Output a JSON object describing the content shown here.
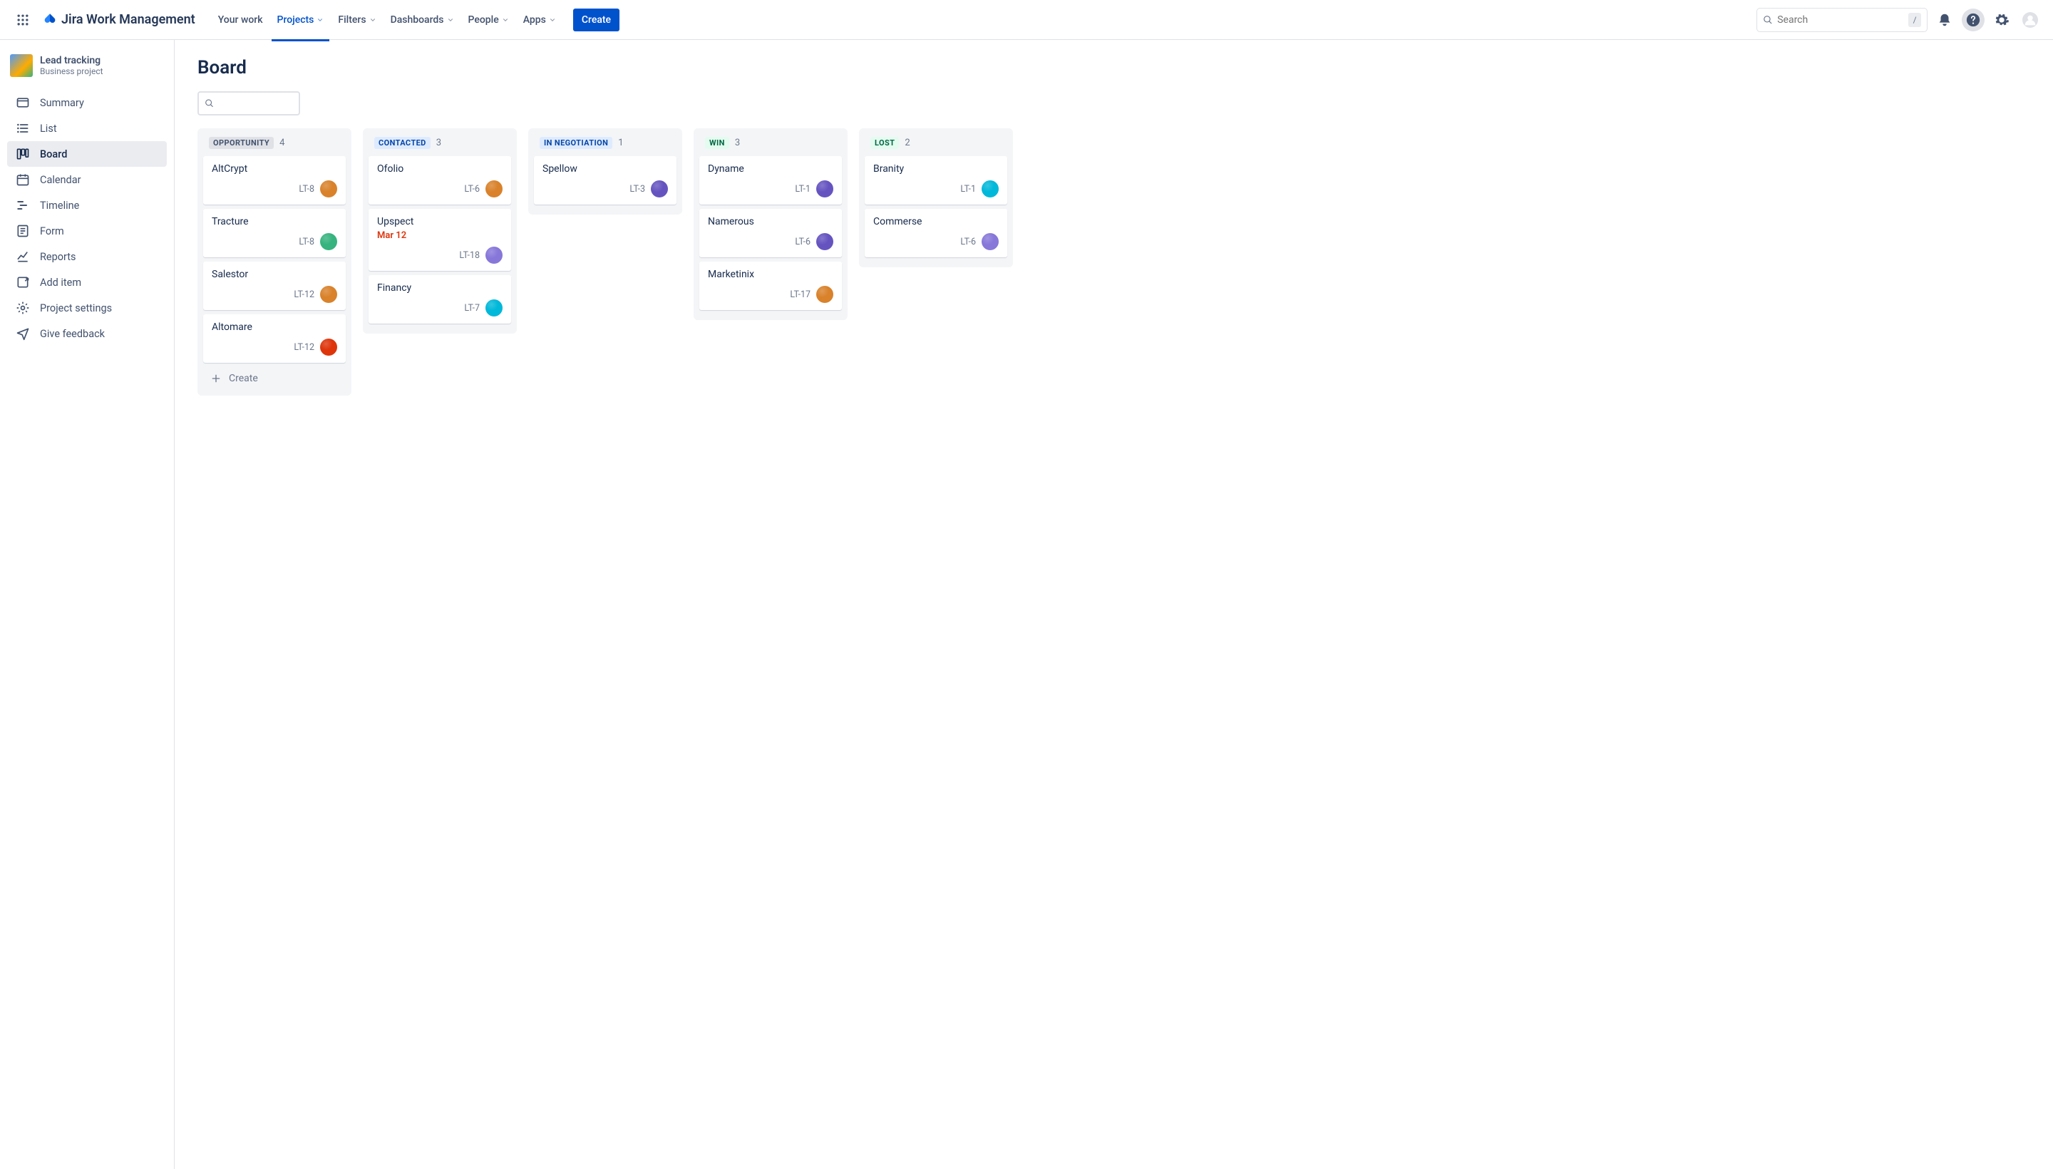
{
  "app": {
    "name": "Jira Work Management"
  },
  "nav": {
    "items": [
      {
        "label": "Your work",
        "dropdown": false,
        "active": false
      },
      {
        "label": "Projects",
        "dropdown": true,
        "active": true
      },
      {
        "label": "Filters",
        "dropdown": true,
        "active": false
      },
      {
        "label": "Dashboards",
        "dropdown": true,
        "active": false
      },
      {
        "label": "People",
        "dropdown": true,
        "active": false
      },
      {
        "label": "Apps",
        "dropdown": true,
        "active": false
      }
    ],
    "create": "Create",
    "search_placeholder": "Search",
    "search_kbd": "/"
  },
  "project": {
    "name": "Lead tracking",
    "type": "Business project"
  },
  "sidebar": [
    {
      "icon": "summary",
      "label": "Summary"
    },
    {
      "icon": "list",
      "label": "List"
    },
    {
      "icon": "board",
      "label": "Board",
      "active": true
    },
    {
      "icon": "calendar",
      "label": "Calendar"
    },
    {
      "icon": "timeline",
      "label": "Timeline"
    },
    {
      "icon": "form",
      "label": "Form"
    },
    {
      "icon": "reports",
      "label": "Reports"
    },
    {
      "icon": "add",
      "label": "Add item"
    },
    {
      "icon": "settings",
      "label": "Project settings"
    },
    {
      "icon": "feedback",
      "label": "Give feedback"
    }
  ],
  "page": {
    "title": "Board",
    "create_label": "Create"
  },
  "columns": [
    {
      "name": "OPPORTUNITY",
      "count": 4,
      "color_bg": "#DFE1E6",
      "color_fg": "#42526E",
      "cards": [
        {
          "title": "AltCrypt",
          "key": "LT-8",
          "avatar": "#D9822B"
        },
        {
          "title": "Tracture",
          "key": "LT-8",
          "avatar": "#36B37E"
        },
        {
          "title": "Salestor",
          "key": "LT-12",
          "avatar": "#D9822B"
        },
        {
          "title": "Altomare",
          "key": "LT-12",
          "avatar": "#DE350B"
        }
      ],
      "show_create": true
    },
    {
      "name": "CONTACTED",
      "count": 3,
      "color_bg": "#DEEBFF",
      "color_fg": "#0747A6",
      "cards": [
        {
          "title": "Ofolio",
          "key": "LT-6",
          "avatar": "#D9822B"
        },
        {
          "title": "Upspect",
          "date": "Mar 12",
          "date_color": "#DE350B",
          "key": "LT-18",
          "avatar": "#8777D9"
        },
        {
          "title": "Financy",
          "key": "LT-7",
          "avatar": "#00B8D9"
        }
      ]
    },
    {
      "name": "IN NEGOTIATION",
      "count": 1,
      "color_bg": "#DEEBFF",
      "color_fg": "#0747A6",
      "cards": [
        {
          "title": "Spellow",
          "key": "LT-3",
          "avatar": "#6554C0"
        }
      ]
    },
    {
      "name": "WIN",
      "count": 3,
      "color_bg": "#E3FCEF",
      "color_fg": "#006644",
      "cards": [
        {
          "title": "Dyname",
          "key": "LT-1",
          "avatar": "#6554C0"
        },
        {
          "title": "Namerous",
          "key": "LT-6",
          "avatar": "#6554C0"
        },
        {
          "title": "Marketinix",
          "key": "LT-17",
          "avatar": "#D9822B"
        }
      ]
    },
    {
      "name": "LOST",
      "count": 2,
      "color_bg": "#E3FCEF",
      "color_fg": "#006644",
      "cards": [
        {
          "title": "Branity",
          "key": "LT-1",
          "avatar": "#00B8D9"
        },
        {
          "title": "Commerse",
          "key": "LT-6",
          "avatar": "#8777D9"
        }
      ]
    }
  ]
}
